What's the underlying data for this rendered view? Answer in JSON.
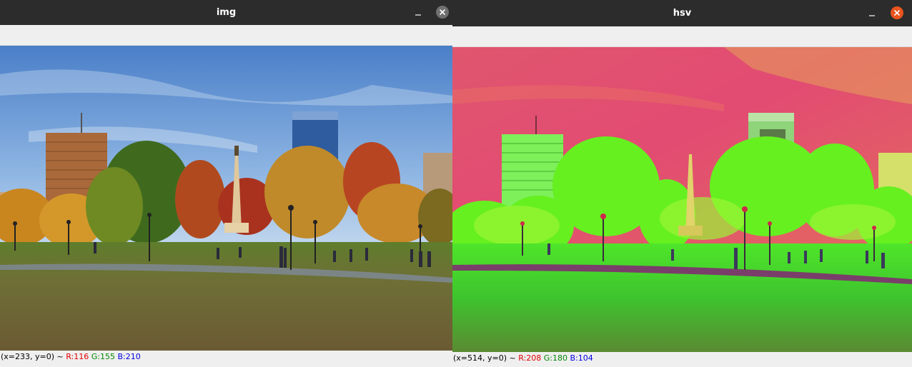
{
  "windows": {
    "img": {
      "title": "img",
      "status": {
        "coords": "(x=233, y=0) ~ ",
        "r": "R:116",
        "g": "G:155",
        "b": "B:210"
      }
    },
    "hsv": {
      "title": "hsv",
      "status": {
        "coords": "(x=514, y=0) ~ ",
        "r": "R:208",
        "g": "G:180",
        "b": "B:104"
      }
    }
  },
  "icons": {
    "minimize": "minimize-icon",
    "close": "close-icon"
  },
  "colors": {
    "titlebar": "#2c2c2c",
    "close_active": "#e9541f",
    "close_inactive": "#6f6f6f",
    "status_r": "#e00000",
    "status_g": "#008800",
    "status_b": "#0000dd"
  }
}
